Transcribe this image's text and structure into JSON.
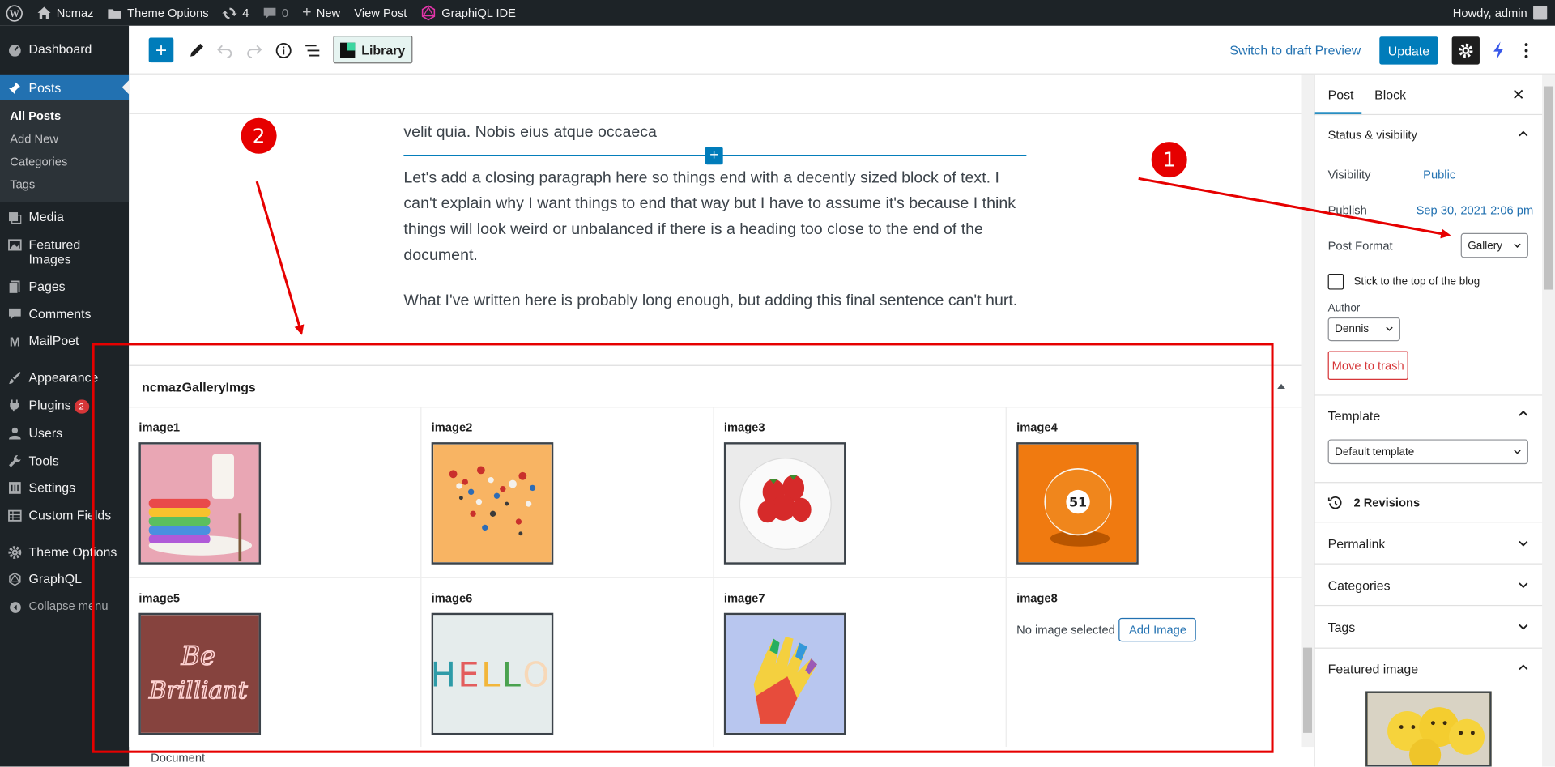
{
  "adminbar": {
    "site_name": "Ncmaz",
    "theme_options": "Theme Options",
    "updates_count": "4",
    "comments_count": "0",
    "new_label": "New",
    "view_post": "View Post",
    "graphiql": "GraphiQL IDE",
    "howdy": "Howdy, admin"
  },
  "sidebar": {
    "dashboard": "Dashboard",
    "posts": "Posts",
    "posts_sub": [
      "All Posts",
      "Add New",
      "Categories",
      "Tags"
    ],
    "media": "Media",
    "featured_images": "Featured Images",
    "pages": "Pages",
    "comments": "Comments",
    "mailpoet": "MailPoet",
    "appearance": "Appearance",
    "plugins": "Plugins",
    "plugins_badge": "2",
    "users": "Users",
    "tools": "Tools",
    "settings": "Settings",
    "custom_fields": "Custom Fields",
    "theme_options": "Theme Options",
    "graphql": "GraphQL",
    "collapse": "Collapse menu"
  },
  "toolbar": {
    "library": "Library",
    "switch_to_draft": "Switch to draft",
    "preview": "Preview",
    "update": "Update"
  },
  "editor": {
    "para_top": "velit quia. Nobis eius atque occaeca",
    "para_1": "Let's add a closing paragraph here so things end with a decently sized block of text. I can't explain why I want things to end that way but I have to assume it's because I think things will look weird or unbalanced if there is a heading too close to the end of the document.",
    "para_2": "What I've written here is probably long enough, but adding this final sentence can't hurt."
  },
  "metabox": {
    "title": "ncmazGalleryImgs",
    "images": [
      {
        "label": "image1",
        "color": "#e9a6b4"
      },
      {
        "label": "image2",
        "color": "#f8b463"
      },
      {
        "label": "image3",
        "color": "#e8e8e8"
      },
      {
        "label": "image4",
        "color": "#f07a10"
      },
      {
        "label": "image5",
        "color": "#6b3a36"
      },
      {
        "label": "image6",
        "color": "#e5ecec"
      },
      {
        "label": "image7",
        "color": "#b8c6ef"
      },
      {
        "label": "image8"
      }
    ],
    "no_image": "No image selected",
    "add_image": "Add Image"
  },
  "footer": {
    "document": "Document"
  },
  "settings": {
    "tab_post": "Post",
    "tab_block": "Block",
    "status_visibility": "Status & visibility",
    "visibility_label": "Visibility",
    "visibility_value": "Public",
    "publish_label": "Publish",
    "publish_value": "Sep 30, 2021 2:06 pm",
    "post_format_label": "Post Format",
    "post_format_value": "Gallery",
    "sticky_label": "Stick to the top of the blog",
    "author_label": "Author",
    "author_value": "Dennis",
    "move_to_trash": "Move to trash",
    "template_title": "Template",
    "template_value": "Default template",
    "revisions": "2 Revisions",
    "permalink": "Permalink",
    "categories": "Categories",
    "tags": "Tags",
    "featured_image": "Featured image"
  },
  "annotations": {
    "marker_1": "1",
    "marker_2": "2"
  },
  "colors": {
    "accent": "#007cba",
    "admin_bg": "#1d2327",
    "annotation_red": "#e60000"
  }
}
